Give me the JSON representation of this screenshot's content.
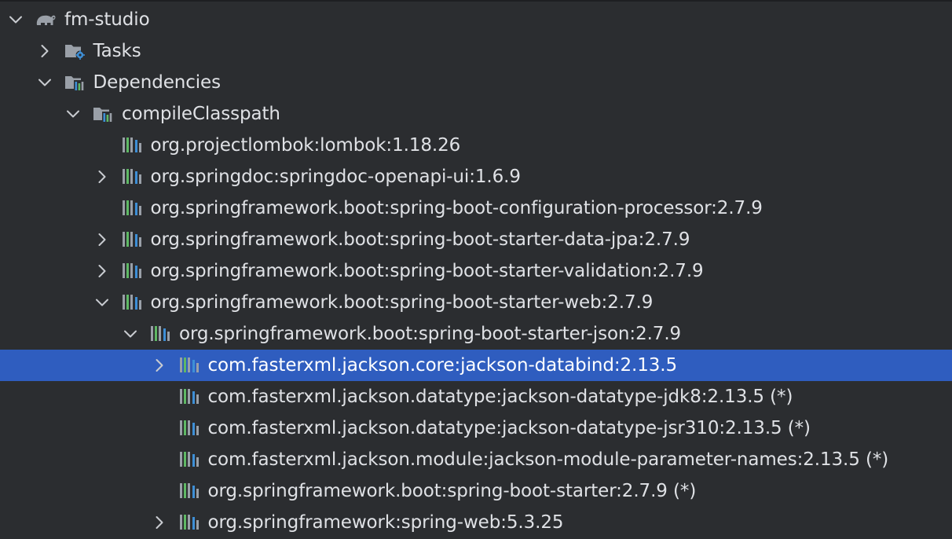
{
  "tree": {
    "rows": [
      {
        "label": "fm-studio",
        "icon": "gradle-elephant-icon",
        "chevron": "down",
        "level": 0
      },
      {
        "label": "Tasks",
        "icon": "tasks-folder-icon",
        "chevron": "right",
        "level": 1
      },
      {
        "label": "Dependencies",
        "icon": "dependencies-folder-icon",
        "chevron": "down",
        "level": 1
      },
      {
        "label": "compileClasspath",
        "icon": "classpath-folder-icon",
        "chevron": "down",
        "level": 2
      },
      {
        "label": "org.projectlombok:lombok:1.18.26",
        "icon": "library-icon",
        "chevron": "none",
        "level": 3
      },
      {
        "label": "org.springdoc:springdoc-openapi-ui:1.6.9",
        "icon": "library-icon",
        "chevron": "right",
        "level": 3
      },
      {
        "label": "org.springframework.boot:spring-boot-configuration-processor:2.7.9",
        "icon": "library-icon",
        "chevron": "none",
        "level": 3
      },
      {
        "label": "org.springframework.boot:spring-boot-starter-data-jpa:2.7.9",
        "icon": "library-icon",
        "chevron": "right",
        "level": 3
      },
      {
        "label": "org.springframework.boot:spring-boot-starter-validation:2.7.9",
        "icon": "library-icon",
        "chevron": "right",
        "level": 3
      },
      {
        "label": "org.springframework.boot:spring-boot-starter-web:2.7.9",
        "icon": "library-icon",
        "chevron": "down",
        "level": 3
      },
      {
        "label": "org.springframework.boot:spring-boot-starter-json:2.7.9",
        "icon": "library-icon",
        "chevron": "down",
        "level": 4
      },
      {
        "label": "com.fasterxml.jackson.core:jackson-databind:2.13.5",
        "icon": "library-icon",
        "chevron": "right",
        "level": 5,
        "selected": true
      },
      {
        "label": "com.fasterxml.jackson.datatype:jackson-datatype-jdk8:2.13.5 (*)",
        "icon": "library-icon",
        "chevron": "none",
        "level": 5
      },
      {
        "label": "com.fasterxml.jackson.datatype:jackson-datatype-jsr310:2.13.5 (*)",
        "icon": "library-icon",
        "chevron": "none",
        "level": 5
      },
      {
        "label": "com.fasterxml.jackson.module:jackson-module-parameter-names:2.13.5 (*)",
        "icon": "library-icon",
        "chevron": "none",
        "level": 5
      },
      {
        "label": "org.springframework.boot:spring-boot-starter:2.7.9 (*)",
        "icon": "library-icon",
        "chevron": "none",
        "level": 5
      },
      {
        "label": "org.springframework:spring-web:5.3.25",
        "icon": "library-icon",
        "chevron": "right",
        "level": 5
      }
    ]
  },
  "colors": {
    "background": "#2b2d30",
    "selection": "#2f5dbf",
    "text": "#dfe1e5",
    "chevron": "#c9ccd1",
    "icon_gray": "#9aa0a8",
    "icon_blue": "#3e8fd6",
    "icon_green": "#5fb865"
  }
}
